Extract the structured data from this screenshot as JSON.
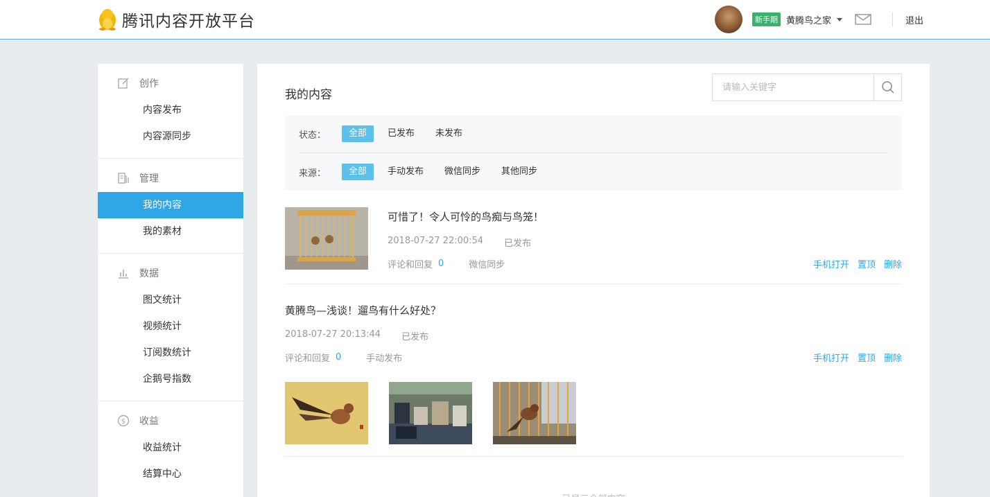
{
  "header": {
    "logo_text": "腾讯内容开放平台",
    "badge": "新手期",
    "username": "黄腾鸟之家",
    "logout": "退出"
  },
  "sidebar": {
    "groups": [
      {
        "title": "创作",
        "icon": "edit-icon",
        "items": [
          "内容发布",
          "内容源同步"
        ]
      },
      {
        "title": "管理",
        "icon": "manage-icon",
        "items": [
          "我的内容",
          "我的素材"
        ]
      },
      {
        "title": "数据",
        "icon": "chart-icon",
        "items": [
          "图文统计",
          "视频统计",
          "订阅数统计",
          "企鹅号指数"
        ]
      },
      {
        "title": "收益",
        "icon": "dollar-icon",
        "items": [
          "收益统计",
          "结算中心"
        ]
      }
    ],
    "active_item": "我的内容"
  },
  "main": {
    "title": "我的内容",
    "search_placeholder": "请输入关键字",
    "filters": {
      "status_label": "状态：",
      "status_options": [
        "全部",
        "已发布",
        "未发布"
      ],
      "source_label": "来源：",
      "source_options": [
        "全部",
        "手动发布",
        "微信同步",
        "其他同步"
      ]
    },
    "articles": [
      {
        "title": "可惜了！令人可怜的鸟痴与鸟笼！",
        "datetime": "2018-07-27 22:00:54",
        "status": "已发布",
        "comments_label": "评论和回复",
        "comments_count": "0",
        "source": "微信同步",
        "actions": [
          "手机打开",
          "置顶",
          "删除"
        ]
      },
      {
        "title": "黄腾鸟—浅谈！遛鸟有什么好处？",
        "datetime": "2018-07-27 20:13:44",
        "status": "已发布",
        "comments_label": "评论和回复",
        "comments_count": "0",
        "source": "手动发布",
        "actions": [
          "手机打开",
          "置顶",
          "删除"
        ]
      }
    ],
    "footer_note": "已显示全部内容"
  },
  "colors": {
    "accent": "#2fa7e6",
    "chip_active": "#5cc1ea",
    "badge": "#37b36a"
  }
}
